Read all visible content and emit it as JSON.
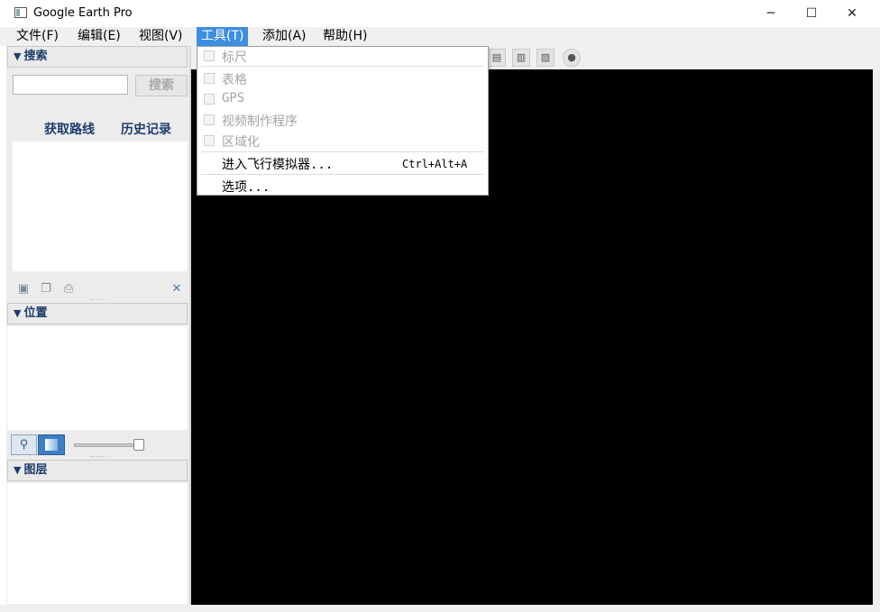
{
  "window": {
    "title": "Google Earth Pro",
    "minimize": "─",
    "maximize": "☐",
    "close": "✕"
  },
  "menubar": {
    "items": [
      "文件(F)",
      "编辑(E)",
      "视图(V)",
      "工具(T)",
      "添加(A)",
      "帮助(H)"
    ],
    "active_index": 3
  },
  "tools_menu": {
    "items": [
      {
        "label": "标尺",
        "enabled": false
      },
      {
        "label": "表格",
        "enabled": false
      },
      {
        "label": "GPS",
        "enabled": false
      },
      {
        "label": "视频制作程序",
        "enabled": false
      },
      {
        "label": "区域化",
        "enabled": false
      },
      {
        "label": "进入飞行模拟器...",
        "shortcut": "Ctrl+Alt+A",
        "enabled": true
      },
      {
        "label": "选项...",
        "enabled": true
      }
    ]
  },
  "search_panel": {
    "header": "搜索",
    "input_value": "",
    "search_button": "搜索",
    "get_directions": "获取路线",
    "history": "历史记录",
    "close_icon": "✕"
  },
  "places_panel": {
    "header": "位置"
  },
  "layers_panel": {
    "header": "图层"
  },
  "colors": {
    "accent": "#3d8ee0",
    "panel_header_text": "#1d3d6d",
    "map_background": "#000000"
  }
}
